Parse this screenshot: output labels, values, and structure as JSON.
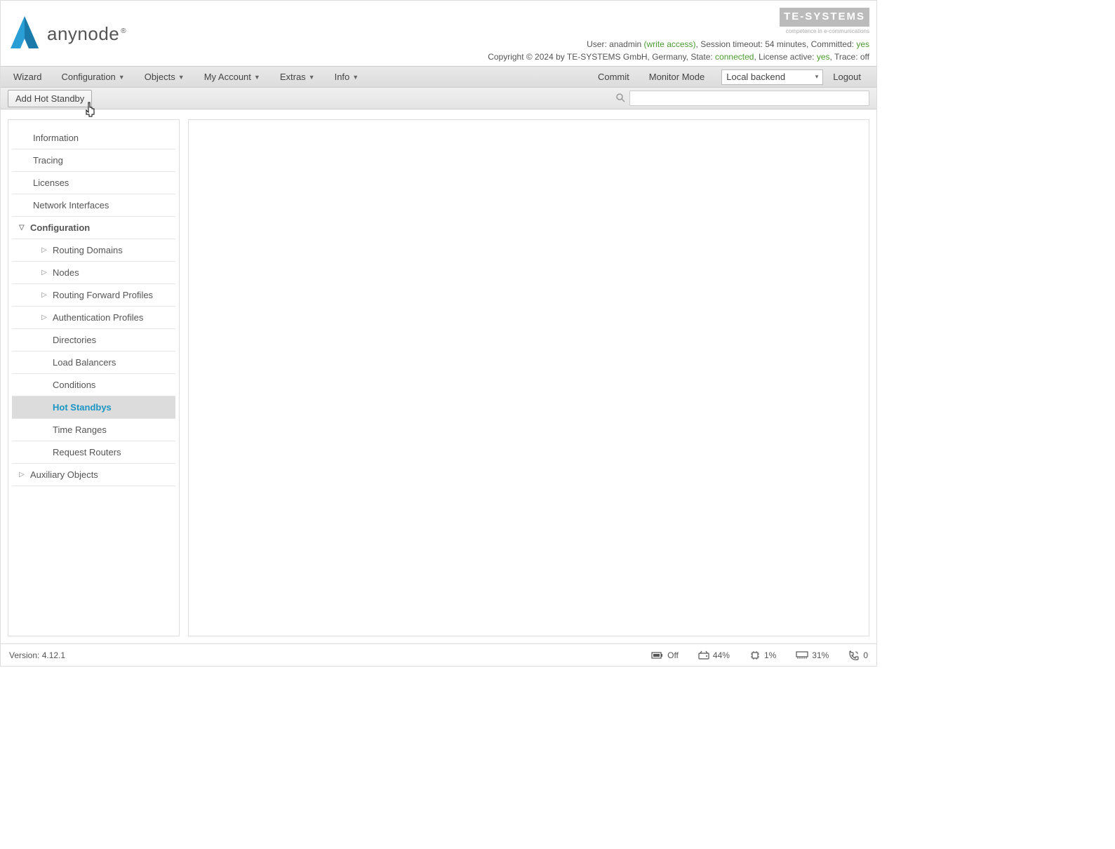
{
  "logo": {
    "text": "anynode"
  },
  "te_systems": {
    "name": "TE-SYSTEMS",
    "tagline": "competence in e-communications"
  },
  "header_status": {
    "user_label": "User: ",
    "user": "anadmin",
    "access": " (write access)",
    "session_label": ", Session timeout: ",
    "session": "54 minutes",
    "committed_label": ", Committed: ",
    "committed": "yes"
  },
  "copyright": {
    "text": "Copyright © 2024 by TE-SYSTEMS GmbH, Germany, State: ",
    "state": "connected",
    "license_label": ", License active: ",
    "license": "yes",
    "trace_label": ", Trace: ",
    "trace": "off"
  },
  "nav": {
    "wizard": "Wizard",
    "configuration": "Configuration",
    "objects": "Objects",
    "my_account": "My Account",
    "extras": "Extras",
    "info": "Info",
    "commit": "Commit",
    "monitor": "Monitor Mode",
    "backend": "Local backend",
    "logout": "Logout"
  },
  "toolbar": {
    "add_label": "Add Hot Standby"
  },
  "sidebar": {
    "information": "Information",
    "tracing": "Tracing",
    "licenses": "Licenses",
    "network": "Network Interfaces",
    "configuration": "Configuration",
    "routing_domains": "Routing Domains",
    "nodes": "Nodes",
    "routing_forward": "Routing Forward Profiles",
    "auth_profiles": "Authentication Profiles",
    "directories": "Directories",
    "load_balancers": "Load Balancers",
    "conditions": "Conditions",
    "hot_standbys": "Hot Standbys",
    "time_ranges": "Time Ranges",
    "request_routers": "Request Routers",
    "auxiliary": "Auxiliary Objects"
  },
  "footer": {
    "version_label": "Version:  ",
    "version": "4.12.1",
    "power": "Off",
    "disk": "44%",
    "cpu": "1%",
    "mem": "31%",
    "calls": "0"
  }
}
